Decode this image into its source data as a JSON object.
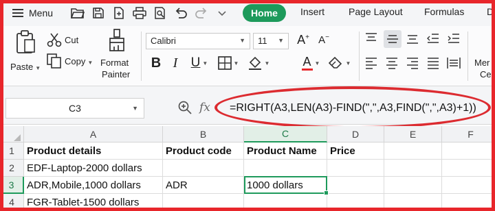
{
  "menubar": {
    "menu_label": "Menu",
    "quick_access_icons": [
      "open-folder-icon",
      "save-icon",
      "export-icon",
      "print-icon",
      "print-preview-icon",
      "undo-icon",
      "redo-icon",
      "more-icon"
    ],
    "tabs": [
      "Home",
      "Insert",
      "Page Layout",
      "Formulas",
      "D"
    ],
    "active_tab": "Home",
    "active_color": "#1d9a5b"
  },
  "ribbon": {
    "paste_label": "Paste",
    "cut_label": "Cut",
    "copy_label": "Copy",
    "format_painter_line1": "Format",
    "format_painter_line2": "Painter",
    "font_name": "Calibri",
    "font_size": "11",
    "partial_label_1": "Mer",
    "partial_label_2": "Ce",
    "font_color": "#e8262b"
  },
  "formula_bar": {
    "name_box": "C3",
    "fx_label": "fx",
    "formula": "=RIGHT(A3,LEN(A3)-FIND(\",\",A3,FIND(\",\",A3)+1))"
  },
  "grid": {
    "columns": [
      "A",
      "B",
      "C",
      "D",
      "E",
      "F"
    ],
    "rows": [
      "1",
      "2",
      "3",
      "4"
    ],
    "cells": {
      "A1": "Product details",
      "B1": "Product code",
      "C1": "Product Name",
      "D1": "Price",
      "A2": "EDF-Laptop-2000 dollars",
      "A3": "ADR,Mobile,1000 dollars",
      "B3": "ADR",
      "C3": "1000 dollars",
      "A4": "FGR-Tablet-1500 dollars"
    },
    "active_cell": "C3",
    "annotation_color": "#dc2b30"
  }
}
